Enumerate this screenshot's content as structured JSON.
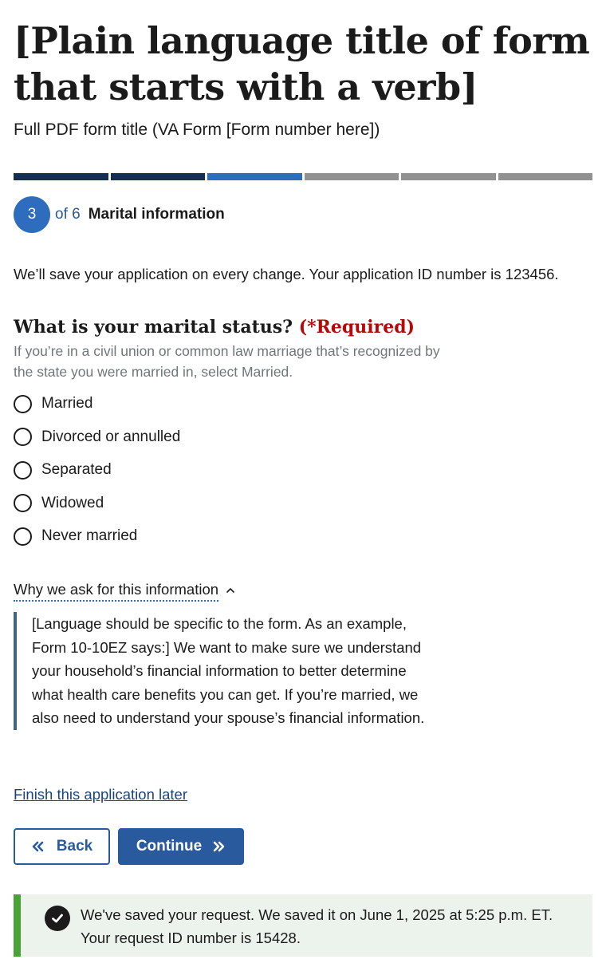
{
  "header": {
    "title": "[Plain language title of form that starts with a verb]",
    "subtitle": "Full PDF form title (VA Form [Form number here])"
  },
  "progress": {
    "total_steps": 6,
    "current_step": 3,
    "colors": {
      "complete": "#162e51",
      "current": "#2e6dbe",
      "incomplete": "#919191"
    }
  },
  "step": {
    "number": "3",
    "of_label": "of 6",
    "name": "Marital information"
  },
  "save_notice": "We’ll save your application on every change. Your application ID number is 123456.",
  "question": {
    "label": "What is your marital status?",
    "required_label": "(*Required)",
    "hint": "If you’re in a civil union or common law marriage that’s recognized by the state you were married in, select Married.",
    "options": [
      {
        "label": "Married",
        "selected": false
      },
      {
        "label": "Divorced or annulled",
        "selected": false
      },
      {
        "label": "Separated",
        "selected": false
      },
      {
        "label": "Widowed",
        "selected": false
      },
      {
        "label": "Never married",
        "selected": false
      }
    ]
  },
  "additional_info": {
    "trigger_label": "Why we ask for this information",
    "icon": "chevron-up-icon",
    "expanded": true,
    "body": "[Language should be specific to the form. As an example, Form 10-10EZ says:] We want to make sure we understand your household’s financial information to better determine what health care benefits you can get. If you’re married, we also need to understand your spouse’s financial information."
  },
  "finish_later_link": "Finish this application later",
  "buttons": {
    "back_label": "Back",
    "back_icon": "double-chevron-left-icon",
    "continue_label": "Continue",
    "continue_icon": "double-chevron-right-icon"
  },
  "alert": {
    "type": "success",
    "icon": "check-circle-icon",
    "message_line1": "We've saved your request. We saved it on June 1, 2025 at 5:25 p.m. ET.",
    "message_line2": "Your request ID number is 15428.",
    "accent_color": "#4aa337",
    "background": "#ecf3ec"
  }
}
